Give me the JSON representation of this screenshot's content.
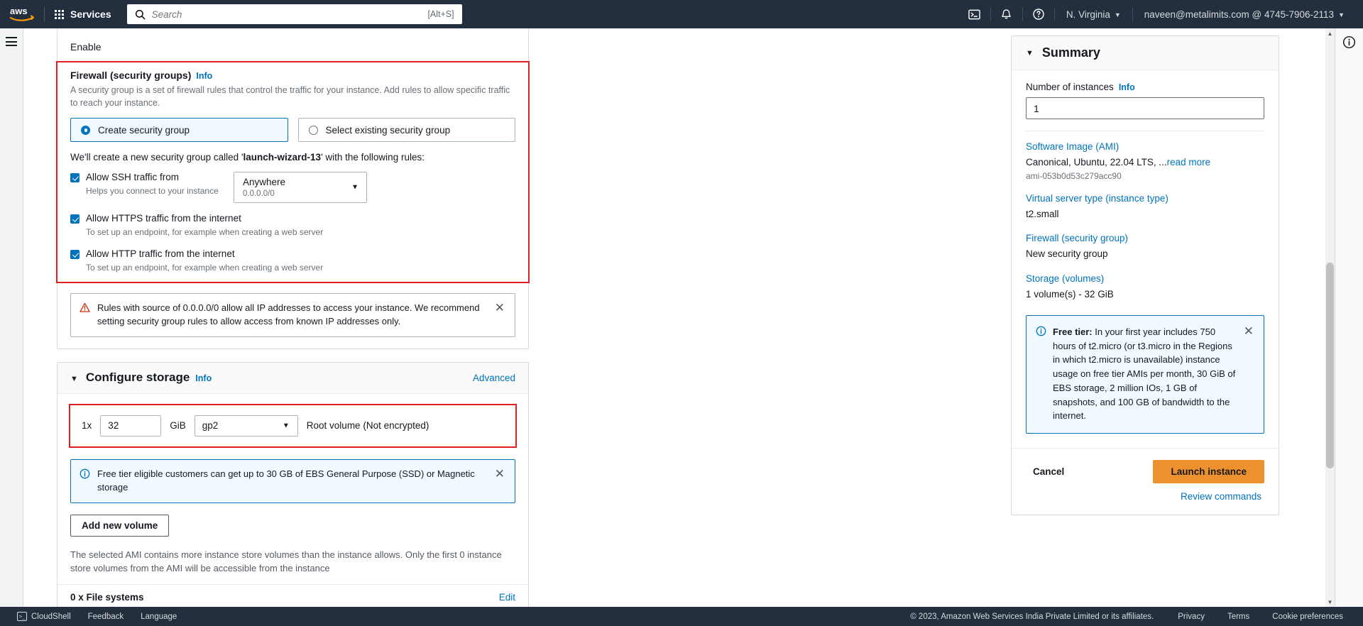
{
  "topnav": {
    "logo": "aws-logo",
    "services_label": "Services",
    "search_placeholder": "Search",
    "search_value": "",
    "search_shortcut": "[Alt+S]",
    "cloudshell_icon": "cloudshell-icon",
    "notifications_icon": "bell-icon",
    "help_icon": "help-circle-icon",
    "region_label": "N. Virginia",
    "account_label": "naveen@metalimits.com @ 4745-7906-2113"
  },
  "form": {
    "enable_label": "Enable",
    "firewall": {
      "title": "Firewall (security groups)",
      "info_label": "Info",
      "description": "A security group is a set of firewall rules that control the traffic for your instance. Add rules to allow specific traffic to reach your instance.",
      "options": [
        {
          "label": "Create security group",
          "selected": true
        },
        {
          "label": "Select existing security group",
          "selected": false
        }
      ],
      "sg_note_prefix": "We'll create a new security group called '",
      "sg_name": "launch-wizard-13",
      "sg_note_suffix": "' with the following rules:",
      "rules": [
        {
          "label": "Allow SSH traffic from",
          "sublabel": "Helps you connect to your instance",
          "checked": true,
          "source_value": "Anywhere",
          "source_cidr": "0.0.0.0/0"
        },
        {
          "label": "Allow HTTPS traffic from the internet",
          "sublabel": "To set up an endpoint, for example when creating a web server",
          "checked": true
        },
        {
          "label": "Allow HTTP traffic from the internet",
          "sublabel": "To set up an endpoint, for example when creating a web server",
          "checked": true
        }
      ],
      "warning": "Rules with source of 0.0.0.0/0 allow all IP addresses to access your instance. We recommend setting security group rules to allow access from known IP addresses only."
    },
    "storage": {
      "title": "Configure storage",
      "info_label": "Info",
      "advanced_label": "Advanced",
      "volume": {
        "count_label": "1x",
        "size_value": "32",
        "unit_label": "GiB",
        "type_value": "gp2",
        "root_label": "Root volume  (Not encrypted)"
      },
      "free_tier_note": "Free tier eligible customers can get up to 30 GB of EBS General Purpose (SSD) or Magnetic storage",
      "add_volume_label": "Add new volume",
      "ami_note": "The selected AMI contains more instance store volumes than the instance allows. Only the first 0 instance store volumes from the AMI will be accessible from the instance",
      "file_systems_label": "0 x File systems",
      "edit_label": "Edit"
    }
  },
  "summary": {
    "title": "Summary",
    "instances_label": "Number of instances",
    "instances_info": "Info",
    "instances_value": "1",
    "items": [
      {
        "link": "Software Image (AMI)",
        "value": "Canonical, Ubuntu, 22.04 LTS, ...",
        "value_link": "read more",
        "sub": "ami-053b0d53c279acc90"
      },
      {
        "link": "Virtual server type (instance type)",
        "value": "t2.small"
      },
      {
        "link": "Firewall (security group)",
        "value": "New security group"
      },
      {
        "link": "Storage (volumes)",
        "value": "1 volume(s) - 32 GiB"
      }
    ],
    "free_tier_bold": "Free tier:",
    "free_tier_text": " In your first year includes 750 hours of t2.micro (or t3.micro in the Regions in which t2.micro is unavailable) instance usage on free tier AMIs per month, 30 GiB of EBS storage, 2 million IOs, 1 GB of snapshots, and 100 GB of bandwidth to the internet.",
    "cancel_label": "Cancel",
    "launch_label": "Launch instance",
    "review_label": "Review commands"
  },
  "footer": {
    "cloudshell_label": "CloudShell",
    "feedback_label": "Feedback",
    "language_label": "Language",
    "copyright": "© 2023, Amazon Web Services India Private Limited or its affiliates.",
    "privacy_label": "Privacy",
    "terms_label": "Terms",
    "cookie_label": "Cookie preferences"
  },
  "colors": {
    "nav_bg": "#232f3e",
    "link": "#0073bb",
    "launch_btn": "#ec912d",
    "highlight_box": "#e02020",
    "info_bg": "#f1faff"
  }
}
